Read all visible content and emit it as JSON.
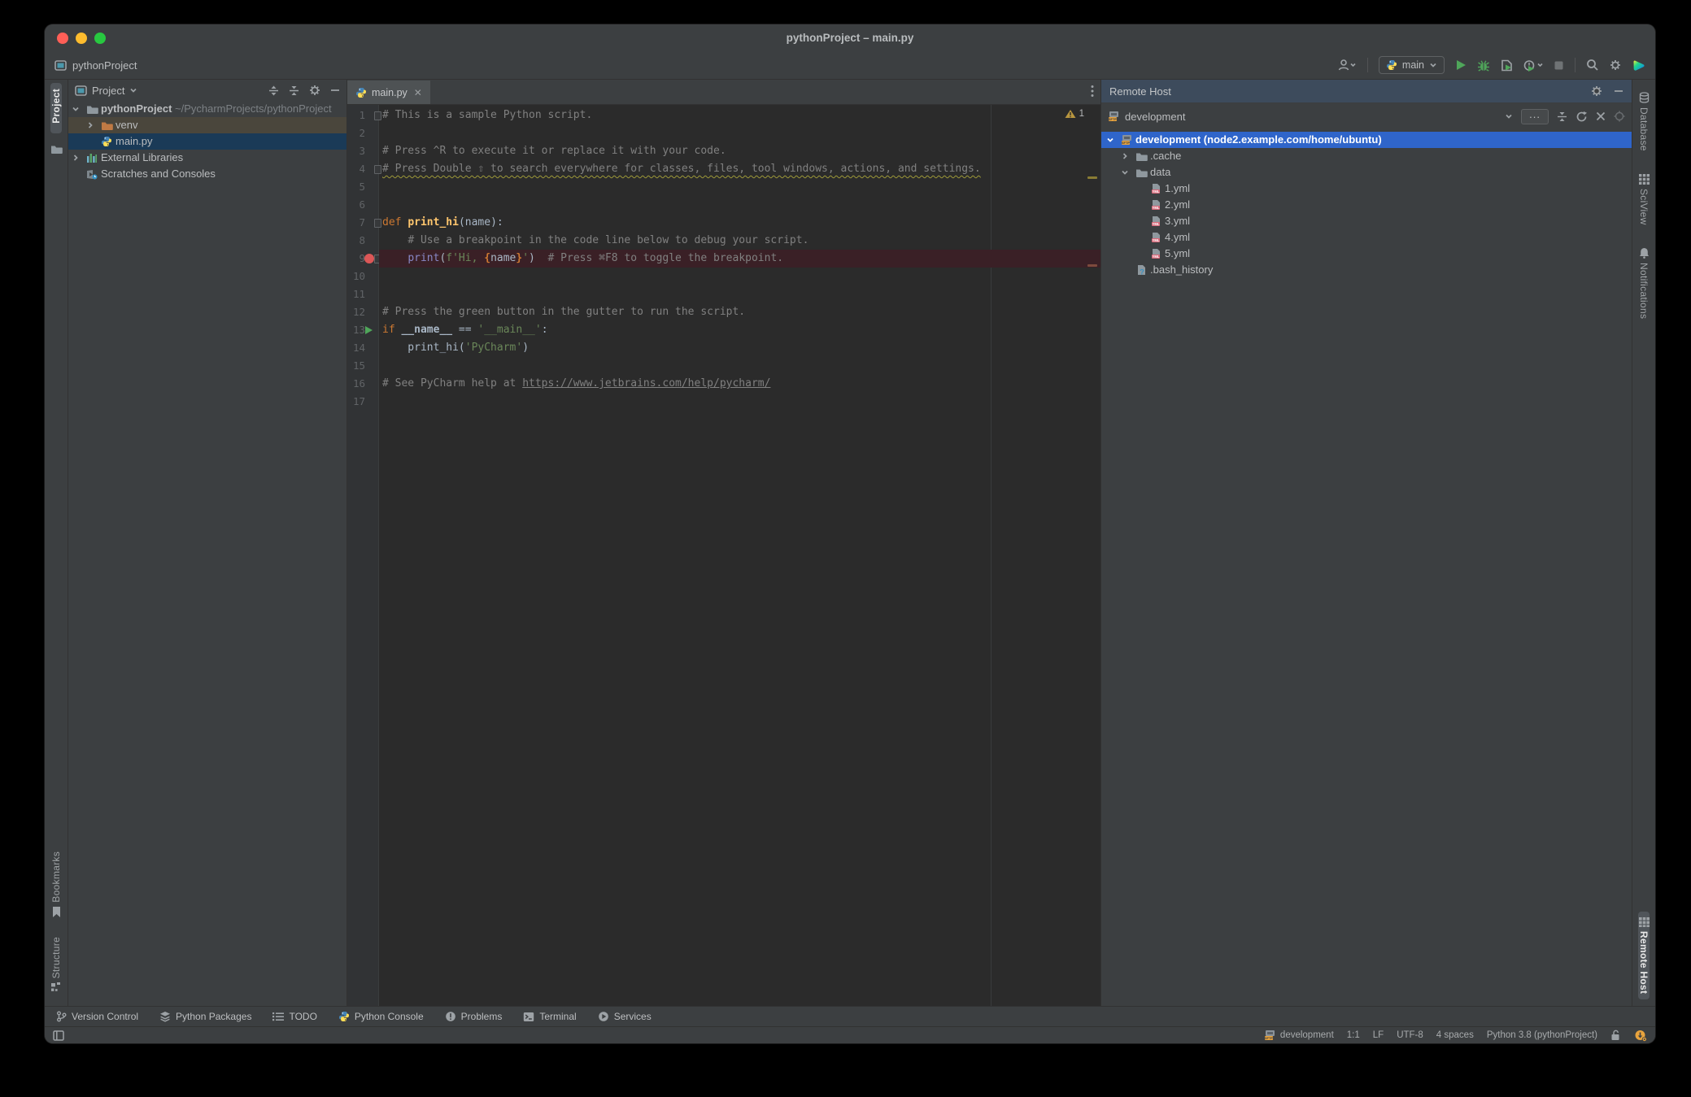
{
  "window": {
    "title": "pythonProject – main.py"
  },
  "toolbar": {
    "project_name": "pythonProject",
    "run_config": "main",
    "colors": {
      "run_green": "#4fa65a",
      "accent_blue": "#2f65ca"
    }
  },
  "left_stripe": {
    "top_tabs": [
      {
        "icon": "",
        "label": "Project",
        "active": true
      },
      {
        "icon": "folder",
        "label": ""
      }
    ],
    "bottom_tabs": [
      {
        "icon": "bookmark",
        "label": "Bookmarks"
      },
      {
        "icon": "structure",
        "label": "Structure"
      }
    ]
  },
  "right_stripe": {
    "top_tabs": [
      {
        "icon": "database",
        "label": "Database"
      },
      {
        "icon": "grid",
        "label": "SciView"
      },
      {
        "icon": "bell",
        "label": "Notifications"
      }
    ],
    "bottom_tabs": [
      {
        "icon": "remote-host",
        "label": "Remote Host",
        "active": true
      }
    ]
  },
  "project_panel": {
    "header": "Project",
    "tree": [
      {
        "level": 0,
        "chevron": "down",
        "icon": "folder",
        "label": "pythonProject",
        "bold": true,
        "suffix": " ~/PycharmProjects/pythonProject"
      },
      {
        "level": 1,
        "chevron": "right",
        "icon": "folder-excluded",
        "label": "venv",
        "row": "hl-brown"
      },
      {
        "level": 1,
        "chevron": "",
        "icon": "python",
        "label": "main.py",
        "row": "sel-navy"
      },
      {
        "level": 0,
        "chevron": "right",
        "icon": "libraries",
        "label": "External Libraries"
      },
      {
        "level": 0,
        "chevron": "",
        "icon": "scratches",
        "label": "Scratches and Consoles"
      }
    ]
  },
  "editor": {
    "tab_label": "main.py",
    "warning_count": "1",
    "lines": [
      {
        "n": 1,
        "fold": true,
        "tokens": [
          [
            "comment",
            "# This is a sample Python script."
          ]
        ]
      },
      {
        "n": 2,
        "tokens": []
      },
      {
        "n": 3,
        "tokens": [
          [
            "comment",
            "# Press ^R to execute it or replace it with your code."
          ]
        ]
      },
      {
        "n": 4,
        "fold": true,
        "tokens": [
          [
            "comment-warn",
            "# Press Double ⇧ to search everywhere for classes, files, tool windows, actions, and settings."
          ]
        ]
      },
      {
        "n": 5,
        "tokens": []
      },
      {
        "n": 6,
        "tokens": []
      },
      {
        "n": 7,
        "fold": true,
        "tokens": [
          [
            "kw",
            "def "
          ],
          [
            "fn",
            "print_hi"
          ],
          [
            "plain",
            "(name):"
          ]
        ]
      },
      {
        "n": 8,
        "tokens": [
          [
            "plain",
            "    "
          ],
          [
            "comment",
            "# Use a breakpoint in the code line below to debug your script."
          ]
        ]
      },
      {
        "n": 9,
        "fold": true,
        "breakpoint": true,
        "tokens": [
          [
            "plain",
            "    "
          ],
          [
            "builtin",
            "print"
          ],
          [
            "plain",
            "("
          ],
          [
            "str",
            "f'Hi, "
          ],
          [
            "brace",
            "{"
          ],
          [
            "plain",
            "name"
          ],
          [
            "brace",
            "}"
          ],
          [
            "str",
            "'"
          ],
          [
            "plain",
            ")"
          ],
          [
            "comment",
            "  # Press ⌘F8 to toggle the breakpoint."
          ]
        ]
      },
      {
        "n": 10,
        "tokens": []
      },
      {
        "n": 11,
        "tokens": []
      },
      {
        "n": 12,
        "tokens": [
          [
            "comment",
            "# Press the green button in the gutter to run the script."
          ]
        ]
      },
      {
        "n": 13,
        "run": true,
        "tokens": [
          [
            "kw",
            "if "
          ],
          [
            "plain-b",
            "__name__"
          ],
          [
            "plain",
            " == "
          ],
          [
            "str",
            "'__main__'"
          ],
          [
            "plain",
            ":"
          ]
        ]
      },
      {
        "n": 14,
        "tokens": [
          [
            "plain",
            "    print_hi("
          ],
          [
            "str",
            "'PyCharm'"
          ],
          [
            "plain",
            ")"
          ]
        ]
      },
      {
        "n": 15,
        "tokens": []
      },
      {
        "n": 16,
        "tokens": [
          [
            "comment",
            "# See PyCharm help at "
          ],
          [
            "comment-link",
            "https://www.jetbrains.com/help/pycharm/"
          ]
        ]
      },
      {
        "n": 17,
        "tokens": []
      }
    ]
  },
  "remote_host": {
    "header": "Remote Host",
    "connection": "development",
    "tree": [
      {
        "level": 0,
        "chevron": "down",
        "icon": "sftp",
        "label": "development (node2.example.com/home/ubuntu)",
        "bold": true,
        "row": "sel-blue"
      },
      {
        "level": 1,
        "chevron": "right",
        "icon": "folder",
        "label": ".cache"
      },
      {
        "level": 1,
        "chevron": "down",
        "icon": "folder",
        "label": "data"
      },
      {
        "level": 2,
        "chevron": "",
        "icon": "yml",
        "label": "1.yml"
      },
      {
        "level": 2,
        "chevron": "",
        "icon": "yml",
        "label": "2.yml"
      },
      {
        "level": 2,
        "chevron": "",
        "icon": "yml",
        "label": "3.yml"
      },
      {
        "level": 2,
        "chevron": "",
        "icon": "yml",
        "label": "4.yml"
      },
      {
        "level": 2,
        "chevron": "",
        "icon": "yml",
        "label": "5.yml"
      },
      {
        "level": 1,
        "chevron": "",
        "icon": "unknown",
        "label": ".bash_history"
      }
    ]
  },
  "bottom_bar": {
    "items": [
      {
        "icon": "branch",
        "label": "Version Control"
      },
      {
        "icon": "layers",
        "label": "Python Packages"
      },
      {
        "icon": "checklist",
        "label": "TODO"
      },
      {
        "icon": "python",
        "label": "Python Console"
      },
      {
        "icon": "problems",
        "label": "Problems"
      },
      {
        "icon": "terminal",
        "label": "Terminal"
      },
      {
        "icon": "services",
        "label": "Services"
      }
    ]
  },
  "status_bar": {
    "items": [
      {
        "icon": "sftp",
        "label": "development"
      },
      {
        "label": "1:1"
      },
      {
        "label": "LF"
      },
      {
        "label": "UTF-8"
      },
      {
        "label": "4 spaces"
      },
      {
        "label": "Python 3.8 (pythonProject)"
      },
      {
        "icon": "unlock",
        "label": ""
      },
      {
        "icon": "event",
        "label": ""
      }
    ]
  }
}
